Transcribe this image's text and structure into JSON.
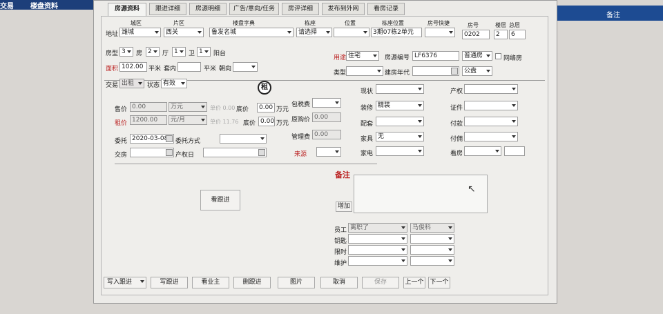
{
  "topbar": {
    "left_items": [
      "交易",
      "楼盘资料"
    ],
    "right_title": "备注"
  },
  "tabs": [
    "房源资料",
    "跟进详细",
    "房源明细",
    "广告/意向/任务",
    "房评详细",
    "发布到外网",
    "看房记录"
  ],
  "address": {
    "headers": {
      "district": "城区",
      "area": "片区",
      "estate": "楼盘字典",
      "building": "栋座",
      "position": "位置",
      "building_position": "栋座位置",
      "quick": "房号快捷",
      "room_no": "房号",
      "floor": "楼层",
      "total_floors": "总层"
    },
    "label": "地址",
    "district": "潍城",
    "area": "西关",
    "estate": "鲁发名城",
    "building": "请选择",
    "position": "",
    "building_position": "3期07栋2单元",
    "quick": "",
    "room_no": "0202",
    "floor": "2",
    "total_floors": "6"
  },
  "layout": {
    "label": "房型",
    "rooms": "3",
    "rooms_unit": "房",
    "halls": "2",
    "halls_unit": "厅",
    "kitchens": "1",
    "kitchens_unit": "卫",
    "baths": "1",
    "balcony_unit": "阳台"
  },
  "area_row": {
    "label": "面积",
    "value": "102.00",
    "unit": "平米",
    "inner_label": "套内",
    "inner_value": "",
    "inner_unit": "平米",
    "orientation_label": "朝向",
    "orientation": ""
  },
  "usage": {
    "label": "用途",
    "value": "住宅",
    "listing_no_label": "房源编号",
    "listing_no": "LF6376",
    "listing_type": "普通房",
    "net_label": "网络房",
    "type_label": "类型",
    "type": "",
    "year_label": "建房年代",
    "year": "",
    "disclosure": "公盘"
  },
  "trade": {
    "label": "交易",
    "value": "出租",
    "status_label": "状态",
    "status": "有效",
    "stamp": "租"
  },
  "price": {
    "sale_label": "售价",
    "sale_value": "0.00",
    "sale_unit": "万元",
    "sale_unit_price": "单价 0.00",
    "sale_floor_label": "底价",
    "sale_floor": "0.00",
    "sale_floor_unit": "万元",
    "rent_label": "租价",
    "rent_value": "1200.00",
    "rent_unit": "元/月",
    "rent_unit_price": "单价 11.76",
    "rent_floor_label": "底价",
    "rent_floor": "0.00",
    "rent_floor_unit": "万元",
    "tax_label": "包税费",
    "tax": "",
    "orig_label": "原购价",
    "orig": "0.00",
    "mgmt_label": "管理费",
    "mgmt": "0.00",
    "source_label": "来源",
    "source": ""
  },
  "entrust": {
    "date_label": "委托",
    "date": "2020-03-08",
    "method_label": "委托方式",
    "method": "",
    "handover_label": "交房",
    "handover": "",
    "deed_date_label": "产权日",
    "deed_date": ""
  },
  "middle": {
    "status_label": "现状",
    "status": "",
    "decoration_label": "装修",
    "decoration": "精装",
    "facilities_label": "配套",
    "facilities": "",
    "furniture_label": "家具",
    "furniture": "无",
    "appliances_label": "家电",
    "appliances": ""
  },
  "right": {
    "ownership_label": "产权",
    "ownership": "",
    "cert_label": "证件",
    "cert": "",
    "payment_label": "付款",
    "payment": "",
    "commission_label": "付佣",
    "commission": "",
    "viewing_label": "看房",
    "viewing": "",
    "viewing_extra": ""
  },
  "remarks": {
    "title": "备注",
    "add_button": "增加",
    "follow_button": "看跟进"
  },
  "staff": {
    "staff_label": "员工",
    "staff_value": "离职了",
    "staff_second": "马俊科",
    "key_label": "钥匙",
    "exclusive_label": "限时",
    "maintain_label": "维护"
  },
  "footer": {
    "write_follow": "写入跟进",
    "write_follow2": "写跟进",
    "view_owner": "看业主",
    "delete_follow": "删跟进",
    "images": "图片",
    "cancel": "取消",
    "save": "保存",
    "prev": "上一个",
    "next": "下一个"
  }
}
